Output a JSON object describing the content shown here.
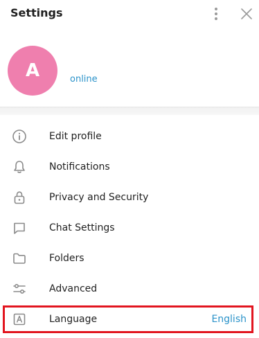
{
  "header": {
    "title": "Settings",
    "menu_icon": "more-vertical-icon",
    "close_icon": "close-icon"
  },
  "profile": {
    "avatar_letter": "A",
    "avatar_color": "#ef7fae",
    "status": "online",
    "status_color": "#2a92c9"
  },
  "menu": {
    "items": [
      {
        "label": "Edit profile",
        "icon": "info-icon"
      },
      {
        "label": "Notifications",
        "icon": "bell-icon"
      },
      {
        "label": "Privacy and Security",
        "icon": "lock-icon"
      },
      {
        "label": "Chat Settings",
        "icon": "chat-icon"
      },
      {
        "label": "Folders",
        "icon": "folder-icon"
      },
      {
        "label": "Advanced",
        "icon": "sliders-icon"
      },
      {
        "label": "Language",
        "icon": "language-icon",
        "value": "English"
      }
    ]
  },
  "highlight_color": "#e2151f"
}
